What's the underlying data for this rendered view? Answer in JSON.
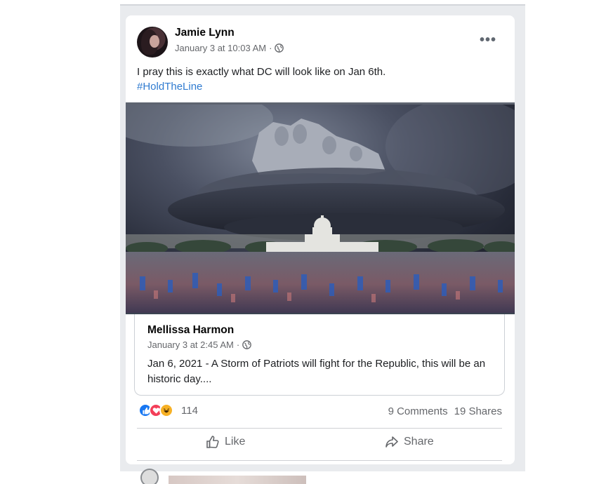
{
  "post": {
    "author": "Jamie Lynn",
    "timestamp": "January 3 at 10:03 AM",
    "separator": "·",
    "more_icon": "more-horizontal-icon",
    "text": "I pray this is exactly what DC will look like on Jan 6th.",
    "hashtag": "#HoldTheLine"
  },
  "shared": {
    "author": "Mellissa Harmon",
    "timestamp": "January 3 at 2:45 AM",
    "separator": "·",
    "text": "Jan 6, 2021 - A Storm of Patriots will fight for the Republic, this will be an historic day...."
  },
  "engagement": {
    "reaction_icons": [
      "like-icon",
      "love-icon",
      "haha-icon"
    ],
    "reaction_count": "114",
    "comments": "9 Comments",
    "shares": "19 Shares"
  },
  "actions": {
    "like_label": "Like",
    "share_label": "Share"
  },
  "colors": {
    "link": "#2f7bd0",
    "like": "#1877f2",
    "love": "#f33e58",
    "haha": "#f7b125",
    "muted": "#65676b"
  }
}
